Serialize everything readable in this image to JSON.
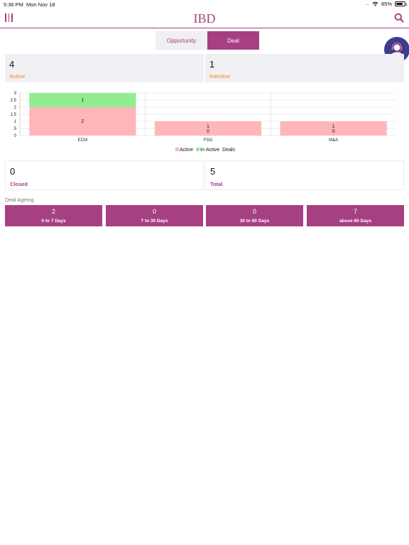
{
  "status_bar": {
    "time": "5:36 PM",
    "date": "Mon Nov 18",
    "signal": ".....",
    "battery": "85%"
  },
  "header": {
    "title": "IBD"
  },
  "tabs": [
    {
      "label": "Opportunity",
      "selected": false
    },
    {
      "label": "Deal",
      "selected": true
    }
  ],
  "cards": {
    "active": {
      "value": "4",
      "label": "Active"
    },
    "inactive": {
      "value": "1",
      "label": "InActive"
    },
    "closed": {
      "value": "0",
      "label": "Closed"
    },
    "total": {
      "value": "5",
      "label": "Total"
    }
  },
  "chart_data": {
    "type": "bar",
    "stacked": true,
    "categories": [
      "ECM",
      "FSG",
      "M&A"
    ],
    "series": [
      {
        "name": "Active",
        "values": [
          2,
          1,
          1
        ],
        "color": "#ffb6b9"
      },
      {
        "name": "In-Active",
        "values": [
          1,
          0,
          0
        ],
        "color": "#90ee90"
      }
    ],
    "yticks": [
      "0",
      ".5",
      "1",
      "1.5",
      "2",
      "2.5",
      "3"
    ],
    "ylim": [
      0,
      3
    ],
    "legend": "bottom",
    "legend_suffix": "Deals"
  },
  "ageing": {
    "title": "Deal Ageing",
    "buckets": [
      {
        "count": "2",
        "label": "0 to 7 Days"
      },
      {
        "count": "0",
        "label": "7 to 30 Days"
      },
      {
        "count": "0",
        "label": "30 to 60 Days"
      },
      {
        "count": "7",
        "label": "above 60 Days"
      }
    ]
  },
  "colors": {
    "brand": "#a64083",
    "accent_orange": "#f2a046",
    "fab": "#3a3f8c"
  },
  "icons": {
    "menu": "menu-icon",
    "search": "search-icon",
    "support": "headset-icon",
    "wifi": "wifi-icon",
    "battery": "battery-icon"
  }
}
